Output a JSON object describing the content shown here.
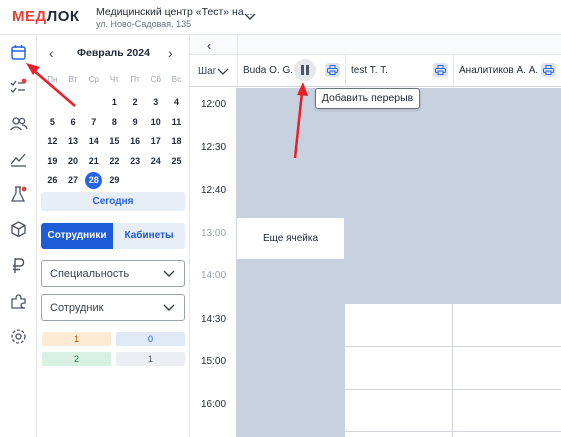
{
  "header": {
    "logo_left": "МЕД",
    "logo_right": "ЛОК",
    "clinic_name": "Медицинский центр «Тест» на ...",
    "clinic_address": "ул. Ново-Садовая, 135"
  },
  "sidebar": {
    "icons": [
      "calendar-icon",
      "checklist-icon",
      "users-icon",
      "chart-icon",
      "flask-icon",
      "box-icon",
      "ruble-icon",
      "puzzle-icon",
      "settings-icon"
    ]
  },
  "calendar": {
    "month": "Февраль 2024",
    "prev": "‹",
    "next": "›",
    "weekdays": [
      "Пн",
      "Вт",
      "Ср",
      "Чт",
      "Пт",
      "Сб",
      "Вс"
    ],
    "days": [
      [
        "",
        "",
        "",
        "1",
        "2",
        "3",
        "4"
      ],
      [
        "5",
        "6",
        "7",
        "8",
        "9",
        "10",
        "11"
      ],
      [
        "12",
        "13",
        "14",
        "15",
        "16",
        "17",
        "18"
      ],
      [
        "19",
        "20",
        "21",
        "22",
        "23",
        "24",
        "25"
      ],
      [
        "26",
        "27",
        "28",
        "29",
        "",
        "",
        ""
      ]
    ],
    "selected_day": "28",
    "today_label": "Сегодня"
  },
  "filters": {
    "tab_staff": "Сотрудники",
    "tab_rooms": "Кабинеты",
    "specialty_label": "Специальность",
    "employee_label": "Сотрудник",
    "counters": [
      "1",
      "0",
      "2",
      "1"
    ]
  },
  "schedule": {
    "back": "‹",
    "step_label": "Шаг",
    "columns": [
      {
        "name": "Buda O. G."
      },
      {
        "name": "test T. T."
      },
      {
        "name": "Аналитиков А. А."
      }
    ],
    "times": [
      "12:00",
      "12:30",
      "12:40",
      "13:00",
      "14:00",
      "14:30",
      "15:00",
      "16:00"
    ],
    "more_cells": "Еще ячейка",
    "tooltip": "Добавить перерыв"
  },
  "colors": {
    "brand_red": "#e8413c",
    "accent_blue": "#1d5bd7",
    "busy_slot": "#c8d1df",
    "arrow_red": "#e8202a"
  }
}
